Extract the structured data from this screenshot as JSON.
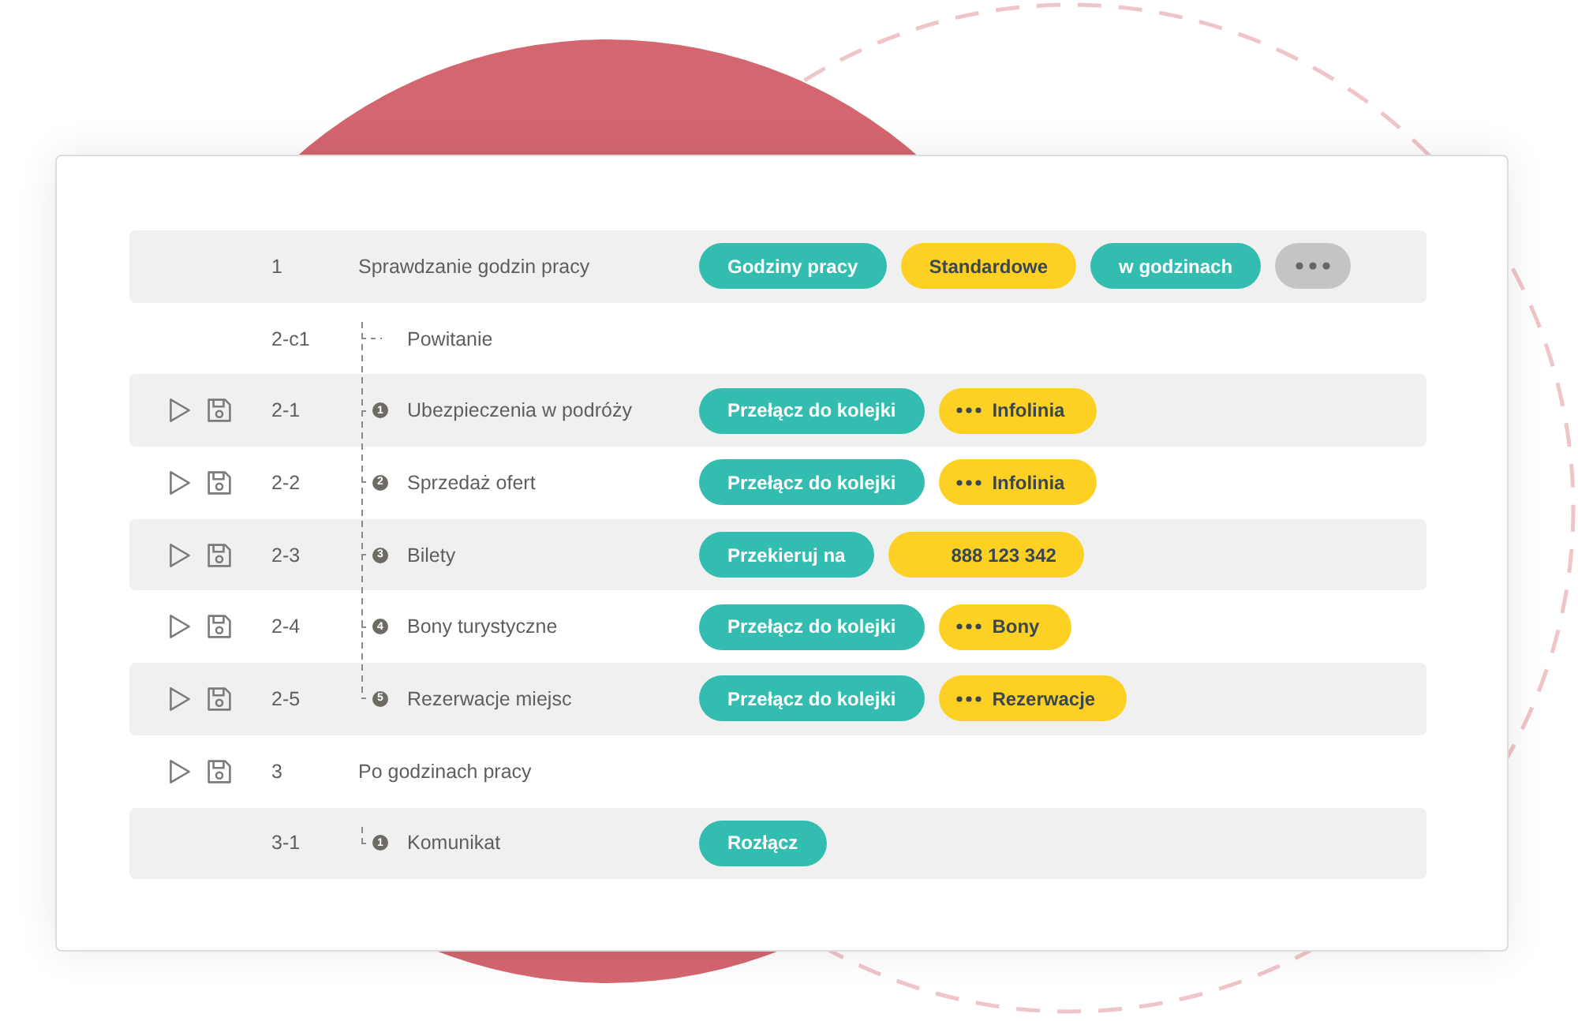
{
  "steps": [
    {
      "number": "1",
      "label": "Sprawdzanie godzin pracy",
      "controls": false,
      "actions": [
        {
          "kind": "action",
          "text": "Godziny pracy"
        },
        {
          "kind": "value",
          "text": "Standardowe"
        },
        {
          "kind": "action",
          "text": "w godzinach"
        },
        {
          "kind": "more"
        }
      ],
      "children": [
        {
          "number": "2-c1",
          "label": "Powitanie",
          "controls": false
        },
        {
          "number": "2-1",
          "badge": "1",
          "label": "Ubezpieczenia w podróży",
          "controls": true,
          "actions": [
            {
              "kind": "action",
              "text": "Przełącz do kolejki"
            },
            {
              "kind": "queue",
              "text": "Infolinia"
            }
          ]
        },
        {
          "number": "2-2",
          "badge": "2",
          "label": "Sprzedaż ofert",
          "controls": true,
          "actions": [
            {
              "kind": "action",
              "text": "Przełącz do kolejki"
            },
            {
              "kind": "queue",
              "text": "Infolinia"
            }
          ]
        },
        {
          "number": "2-3",
          "badge": "3",
          "label": "Bilety",
          "controls": true,
          "actions": [
            {
              "kind": "action",
              "text": "Przekieruj na"
            },
            {
              "kind": "number",
              "text": "888 123 342"
            }
          ]
        },
        {
          "number": "2-4",
          "badge": "4",
          "label": "Bony turystyczne",
          "controls": true,
          "actions": [
            {
              "kind": "action",
              "text": "Przełącz do kolejki"
            },
            {
              "kind": "queue",
              "text": "Bony"
            }
          ]
        },
        {
          "number": "2-5",
          "badge": "5",
          "label": "Rezerwacje miejsc",
          "controls": true,
          "actions": [
            {
              "kind": "action",
              "text": "Przełącz do kolejki"
            },
            {
              "kind": "queue",
              "text": "Rezerwacje"
            }
          ]
        }
      ]
    },
    {
      "number": "3",
      "label": "Po godzinach pracy",
      "controls": true,
      "children": [
        {
          "number": "3-1",
          "badge": "1",
          "label": "Komunikat",
          "controls": false,
          "actions": [
            {
              "kind": "action",
              "text": "Rozłącz"
            }
          ]
        }
      ]
    }
  ]
}
